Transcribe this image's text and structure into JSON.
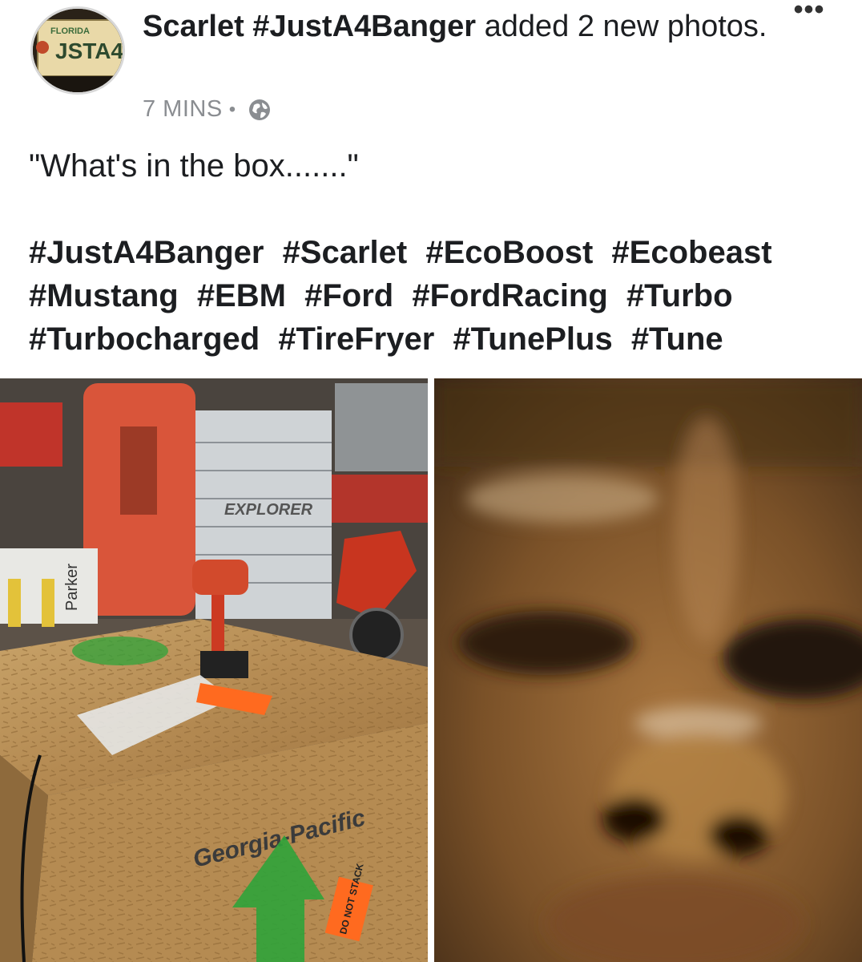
{
  "post": {
    "author_name": "Scarlet #JustA4Banger",
    "action_text": "added 2 new photos.",
    "time_ago": "7 MINS",
    "separator": "•",
    "privacy_icon": "globe-icon",
    "more_icon": "more-options-icon",
    "more_label": "•••",
    "avatar": {
      "plate_state": "FLORIDA",
      "plate_text": "JSTA4"
    },
    "caption": "\"What's in the box.......\"",
    "hashtags": [
      "#JustA4Banger",
      "#Scarlet",
      "#EcoBoost",
      "#Ecobeast",
      "#Mustang",
      "#EBM",
      "#Ford",
      "#FordRacing",
      "#Turbo",
      "#Turbocharged",
      "#TireFryer",
      "#TunePlus",
      "#Tune"
    ],
    "photos": [
      {
        "box_brand": "Georgia-Pacific",
        "sticker_text": "DO NOT STACK",
        "sign_text": "Parker",
        "chest_text": "EXPLORER"
      },
      {}
    ]
  },
  "colors": {
    "text": "#1c1e21",
    "meta": "#8a8d91",
    "box_wood": "#b8925a",
    "arrow_green": "#2fa33a",
    "orange_sticker": "#ff6a1f"
  }
}
